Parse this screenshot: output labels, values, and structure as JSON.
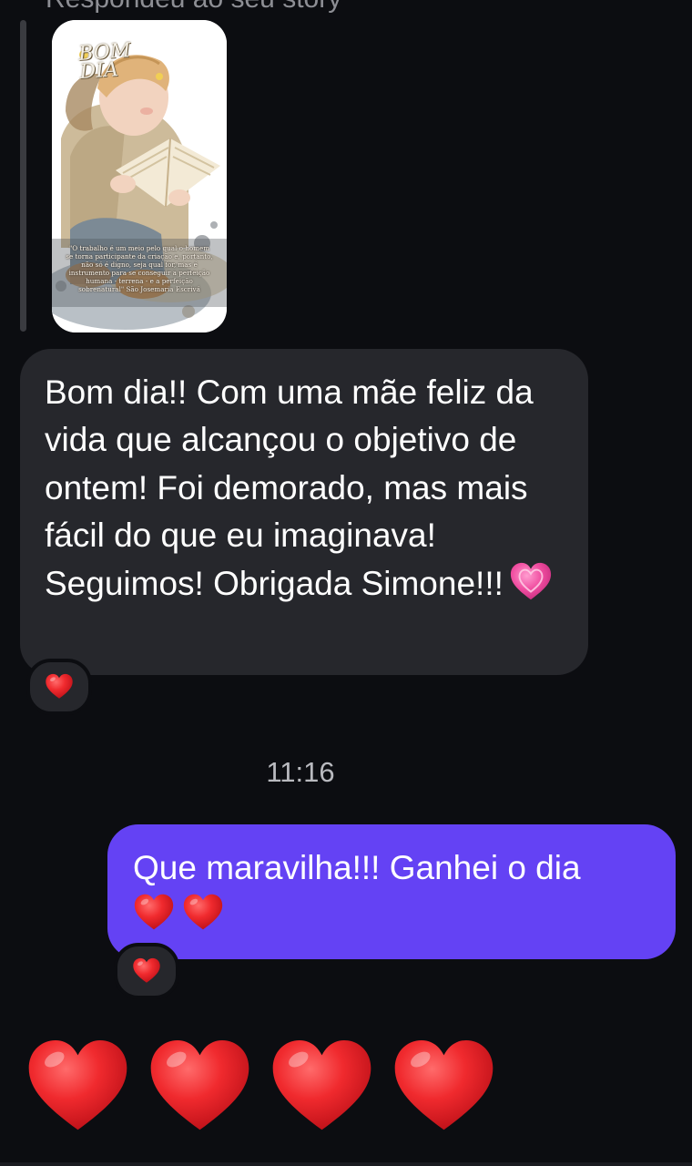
{
  "header": {
    "reply_label": "Respondeu ao seu story"
  },
  "story": {
    "title": "BOM\nDIA",
    "quote": "\"O trabalho é um meio pelo qual o homem se torna participante da criação e, portanto, não só é digno, seja qual for, mas é instrumento para se conseguir a perfeição humana - terrena - e a perfeição sobrenatural\" São Josemaria Escrivá"
  },
  "messages": [
    {
      "direction": "incoming",
      "text": "Bom dia!! Com uma mãe feliz da vida que alcançou o objetivo de ontem! Foi demorado, mas mais fácil do que eu imaginava! Seguimos! Obrigada Simone!!!",
      "emoji": "pink-heart-icon",
      "reaction": "red-heart-icon"
    },
    {
      "direction": "outgoing",
      "text": "Que maravilha!!! Ganhei o dia",
      "emojis": [
        "red-heart-icon",
        "red-heart-icon"
      ],
      "reaction": "red-heart-icon"
    }
  ],
  "timestamp": "11:16",
  "big_hearts": [
    "red-heart-icon",
    "red-heart-icon",
    "red-heart-icon",
    "red-heart-icon"
  ],
  "colors": {
    "background": "#0c0d11",
    "incoming_bubble": "#26272c",
    "outgoing_bubble": "#6442f4",
    "heart": "#e8262d",
    "pink_heart": "#f04da0"
  }
}
